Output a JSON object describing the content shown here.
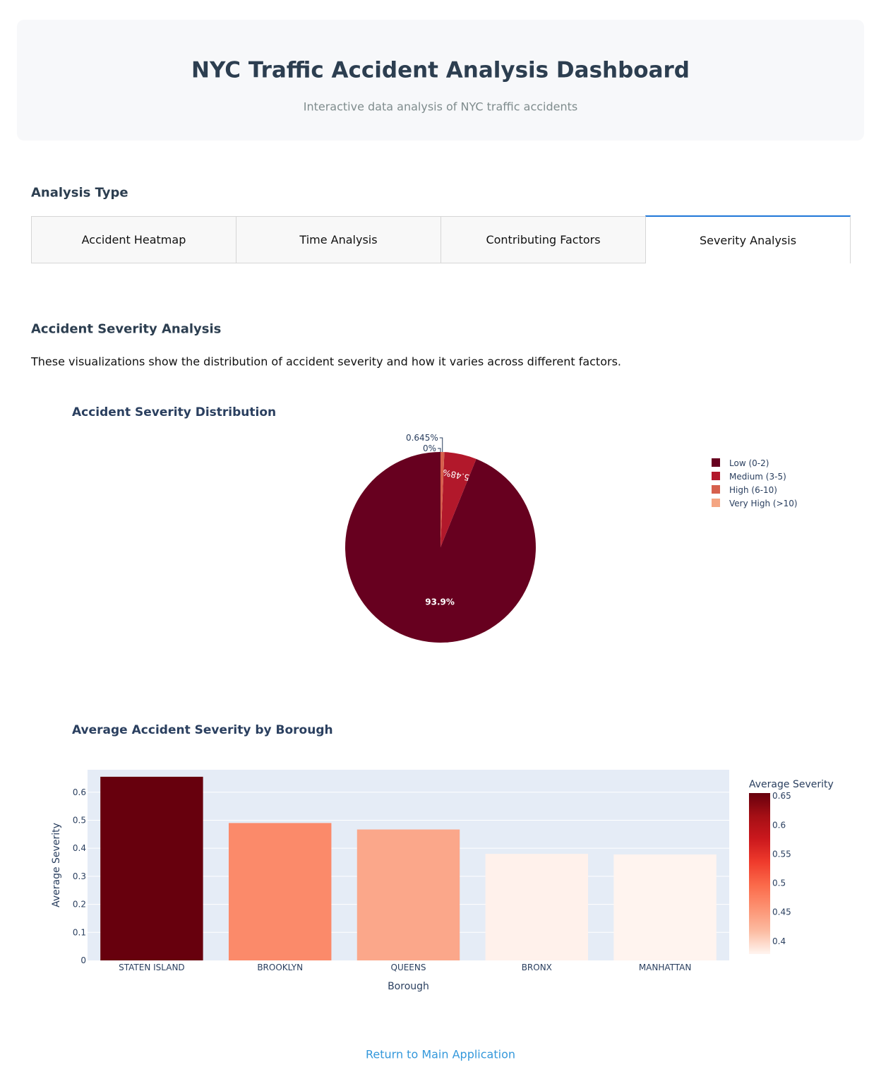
{
  "header": {
    "title": "NYC Traffic Accident Analysis Dashboard",
    "subtitle": "Interactive data analysis of NYC traffic accidents"
  },
  "analysis_type": {
    "label": "Analysis Type",
    "tabs": [
      {
        "label": "Accident Heatmap",
        "active": false
      },
      {
        "label": "Time Analysis",
        "active": false
      },
      {
        "label": "Contributing Factors",
        "active": false
      },
      {
        "label": "Severity Analysis",
        "active": true
      }
    ]
  },
  "section": {
    "title": "Accident Severity Analysis",
    "description": "These visualizations show the distribution of accident severity and how it varies across different factors."
  },
  "chart_data": [
    {
      "type": "pie",
      "title": "Accident Severity Distribution",
      "labels": [
        "Low (0-2)",
        "Medium (3-5)",
        "High (6-10)",
        "Very High (>10)"
      ],
      "values": [
        93.9,
        5.48,
        0.645,
        0.0
      ],
      "text_labels": [
        "93.9%",
        "5.48%",
        "0.645%",
        "0%"
      ],
      "colors": [
        "#67001f",
        "#b2182b",
        "#d6604d",
        "#f4a582"
      ],
      "legend_position": "top-right"
    },
    {
      "type": "bar",
      "title": "Average Accident Severity by Borough",
      "xlabel": "Borough",
      "ylabel": "Average Severity",
      "categories": [
        "STATEN ISLAND",
        "BROOKLYN",
        "QUEENS",
        "BRONX",
        "MANHATTAN"
      ],
      "values": [
        0.655,
        0.49,
        0.467,
        0.38,
        0.378
      ],
      "ylim": [
        0,
        0.68
      ],
      "yticks": [
        0,
        0.1,
        0.2,
        0.3,
        0.4,
        0.5,
        0.6
      ],
      "ytick_labels": [
        "0",
        "0.1",
        "0.2",
        "0.3",
        "0.4",
        "0.5",
        "0.6"
      ],
      "colorbar": {
        "title": "Average Severity",
        "range": [
          0.378,
          0.655
        ],
        "ticks": [
          0.4,
          0.45,
          0.5,
          0.55,
          0.6,
          0.65
        ],
        "tick_labels": [
          "0.4",
          "0.45",
          "0.5",
          "0.55",
          "0.6",
          "0.65"
        ],
        "colorscale": [
          "#fff5f0",
          "#fcbba1",
          "#fc9272",
          "#fb6a4a",
          "#ef3b2c",
          "#cb181d",
          "#a50f15",
          "#67000d"
        ]
      },
      "plot_bg": "#e5ecf6",
      "bar_colors": [
        "#67000d",
        "#fb8a6a",
        "#fba78a",
        "#fff1eb",
        "#fff4ef"
      ]
    }
  ],
  "footer": {
    "return_link": "Return to Main Application"
  }
}
